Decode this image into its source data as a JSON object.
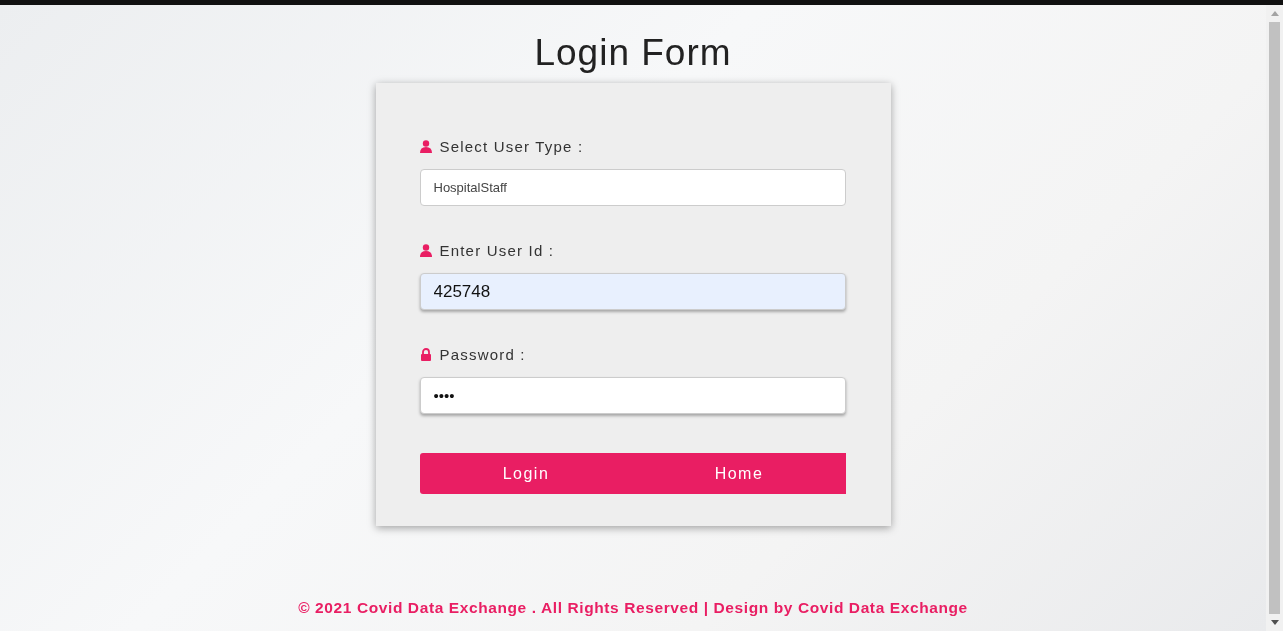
{
  "title": "Login Form",
  "fields": [
    {
      "label": "Select User Type :",
      "kind": "user",
      "value": "HospitalStaff",
      "autofilled": false
    },
    {
      "label": "Enter User Id :",
      "kind": "user",
      "value": "425748",
      "autofilled": true
    },
    {
      "label": "Password :",
      "kind": "lock",
      "value": "••••",
      "autofilled": false
    }
  ],
  "buttons": [
    "Login",
    "Home"
  ],
  "footer": "© 2021 Covid Data Exchange . All Rights Reserved | Design by Covid Data Exchange"
}
